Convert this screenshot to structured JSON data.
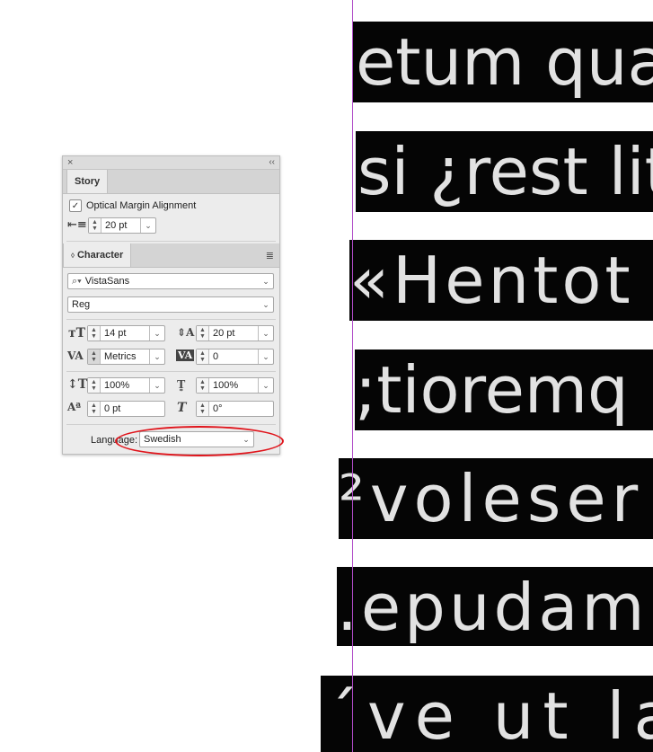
{
  "canvas": {
    "lines": [
      {
        "text": "etum qua"
      },
      {
        "text": "si ¿rest lit"
      },
      {
        "text": "«Hentot"
      },
      {
        "text": ";tioremq"
      },
      {
        "text": "²voleser"
      },
      {
        "text": ".epudam"
      },
      {
        "text": "´ve ut la"
      }
    ]
  },
  "panel": {
    "close_glyph": "×",
    "collapse_glyph": "‹‹",
    "story": {
      "tab_label": "Story",
      "optical_margin_label": "Optical Margin Alignment",
      "optical_margin_checked": true,
      "optical_size_value": "20 pt"
    },
    "character": {
      "tab_label": "Character",
      "font_family": "VistaSans",
      "font_style": "Reg",
      "font_size": "14 pt",
      "leading": "20 pt",
      "kerning": "Metrics",
      "tracking": "0",
      "vertical_scale": "100%",
      "horizontal_scale": "100%",
      "baseline_shift": "0 pt",
      "skew": "0°",
      "language_label": "Language:",
      "language_value": "Swedish"
    }
  },
  "colors": {
    "highlight": "#e0151c",
    "guide": "#b04cc8"
  }
}
